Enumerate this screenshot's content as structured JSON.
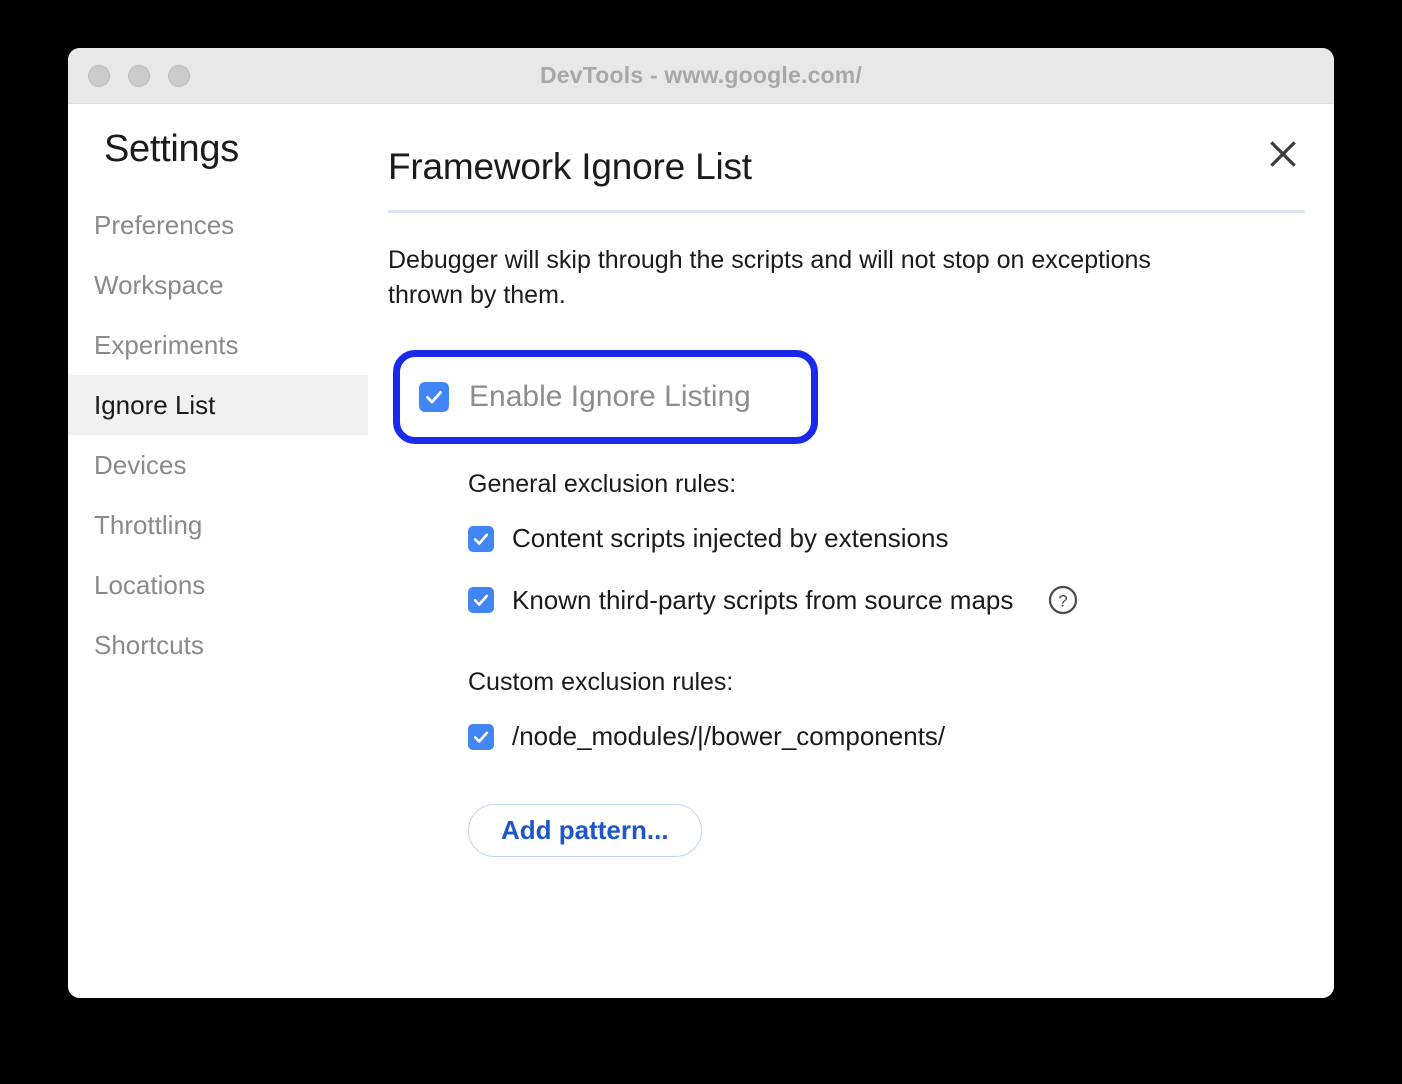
{
  "window": {
    "title": "DevTools - www.google.com/",
    "traffic_lights": [
      "close",
      "minimize",
      "zoom"
    ]
  },
  "sidebar": {
    "heading": "Settings",
    "items": [
      {
        "label": "Preferences",
        "selected": false
      },
      {
        "label": "Workspace",
        "selected": false
      },
      {
        "label": "Experiments",
        "selected": false
      },
      {
        "label": "Ignore List",
        "selected": true
      },
      {
        "label": "Devices",
        "selected": false
      },
      {
        "label": "Throttling",
        "selected": false
      },
      {
        "label": "Locations",
        "selected": false
      },
      {
        "label": "Shortcuts",
        "selected": false
      }
    ]
  },
  "main": {
    "title": "Framework Ignore List",
    "description": "Debugger will skip through the scripts and will not stop on exceptions thrown by them.",
    "close_label": "close-icon",
    "enable": {
      "label": "Enable Ignore Listing",
      "checked": true,
      "highlighted": true
    },
    "general": {
      "label": "General exclusion rules:",
      "rules": [
        {
          "label": "Content scripts injected by extensions",
          "checked": true,
          "help": false
        },
        {
          "label": "Known third-party scripts from source maps",
          "checked": true,
          "help": true
        }
      ]
    },
    "custom": {
      "label": "Custom exclusion rules:",
      "rules": [
        {
          "label": "/node_modules/|/bower_components/",
          "checked": true
        }
      ],
      "add_button": "Add pattern..."
    }
  },
  "colors": {
    "accent_blue": "#4285f4",
    "highlight_blue": "#1a2aea",
    "link_blue": "#1f57c9",
    "divider": "#dce3f7",
    "selected_row": "#f1f1f1",
    "titlebar": "#e9e8e8",
    "desktop": "#000000"
  }
}
